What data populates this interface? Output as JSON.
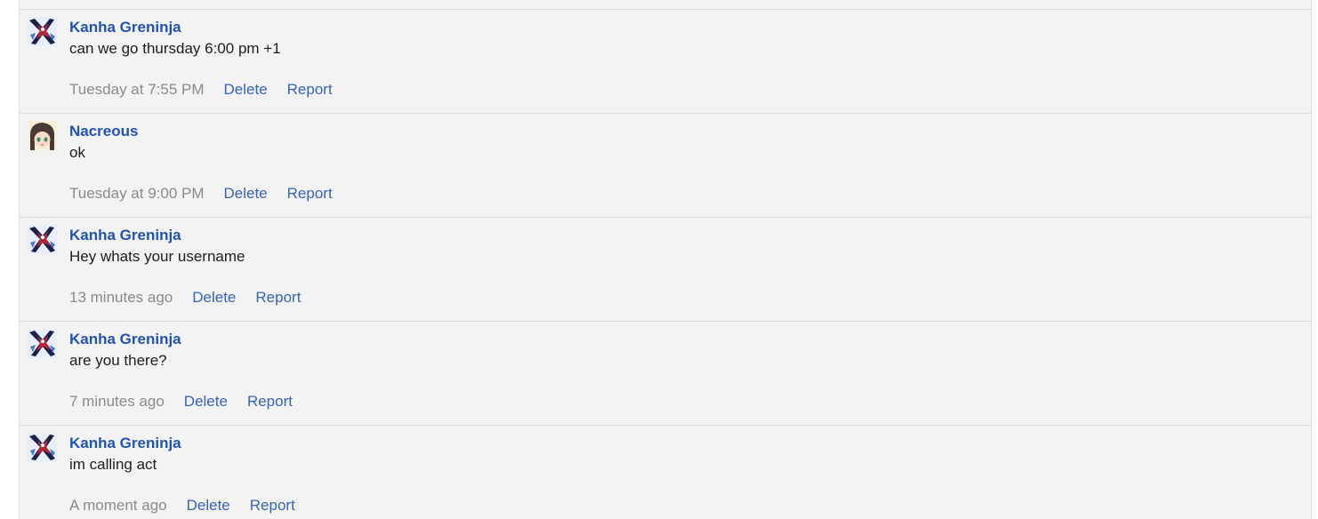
{
  "messages": [
    {
      "author": "Kanha Greninja",
      "text": "can we go thursday 6:00 pm +1",
      "time": "Tuesday at 7:55 PM",
      "delete_label": "Delete",
      "report_label": "Report",
      "avatar_icon": "greninja-avatar-icon"
    },
    {
      "author": "Nacreous",
      "text": "ok",
      "time": "Tuesday at 9:00 PM",
      "delete_label": "Delete",
      "report_label": "Report",
      "avatar_icon": "anime-girl-avatar-icon"
    },
    {
      "author": "Kanha Greninja",
      "text": "Hey whats your username",
      "time": "13 minutes ago",
      "delete_label": "Delete",
      "report_label": "Report",
      "avatar_icon": "greninja-avatar-icon"
    },
    {
      "author": "Kanha Greninja",
      "text": "are you there?",
      "time": "7 minutes ago",
      "delete_label": "Delete",
      "report_label": "Report",
      "avatar_icon": "greninja-avatar-icon"
    },
    {
      "author": "Kanha Greninja",
      "text": "im calling act",
      "time": "A moment ago",
      "delete_label": "Delete",
      "report_label": "Report",
      "avatar_icon": "greninja-avatar-icon"
    }
  ],
  "colors": {
    "panel_bg": "#f3f3f3",
    "author": "#2452b6",
    "link": "#3a64b4",
    "timestamp": "#8a8a8a",
    "divider": "#dcdcdc"
  }
}
